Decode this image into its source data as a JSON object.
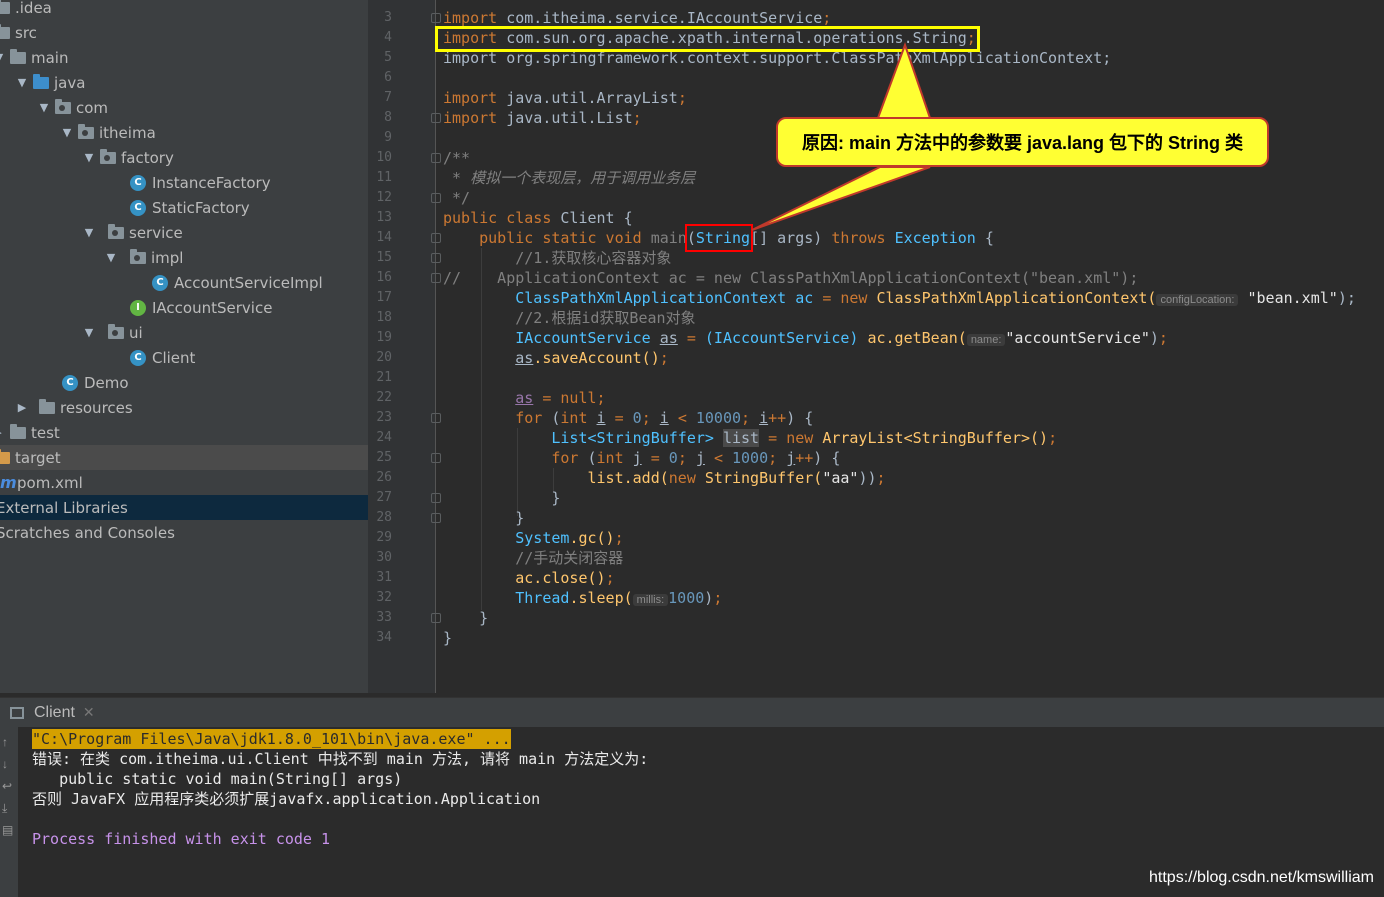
{
  "project_tree": {
    "items": [
      {
        "label": ".idea"
      },
      {
        "label": "src"
      },
      {
        "label": "main"
      },
      {
        "label": "java"
      },
      {
        "label": "com"
      },
      {
        "label": "itheima"
      },
      {
        "label": "factory"
      },
      {
        "label": "InstanceFactory"
      },
      {
        "label": "StaticFactory"
      },
      {
        "label": "service"
      },
      {
        "label": "impl"
      },
      {
        "label": "AccountServiceImpl"
      },
      {
        "label": "IAccountService"
      },
      {
        "label": "ui"
      },
      {
        "label": "Client"
      },
      {
        "label": "Demo"
      },
      {
        "label": "resources"
      },
      {
        "label": "test"
      },
      {
        "label": "target"
      },
      {
        "label": "pom.xml"
      },
      {
        "label": "External Libraries"
      },
      {
        "label": "Scratches and Consoles"
      }
    ]
  },
  "editor": {
    "line_numbers": [
      "3",
      "4",
      "5",
      "6",
      "7",
      "8",
      "9",
      "10",
      "11",
      "12",
      "13",
      "14",
      "15",
      "16",
      "17",
      "18",
      "19",
      "20",
      "21",
      "22",
      "23",
      "24",
      "25",
      "26",
      "27",
      "28",
      "29",
      "30",
      "31",
      "32",
      "33",
      "34"
    ]
  },
  "code": {
    "l3": "import com.itheima.service.IAccountService;",
    "l4_kw": "import",
    "l4_rest": " com.sun.org.apache.xpath.internal.operations.String",
    "l4_semi": ";",
    "l5": "import org.springframework.context.support.ClassPathXmlApplicationContext;",
    "l7_kw": "import",
    "l7_rest": " java.util.ArrayList",
    "l8_kw": "import",
    "l8_rest": " java.util.List",
    "l10": "/**",
    "l11": " * 模拟一个表现层，用于调用业务层",
    "l12": " */",
    "l13_kw": "public class",
    "l13_rest": " Client {",
    "l14_kw": "public static void",
    "l14_main": " main",
    "l14_string": "String",
    "l14_args": "[] args)",
    "l14_throws": "throws",
    "l14_exc": "Exception",
    "l15": "//1.获取核心容器对象",
    "l16": "//    ApplicationContext ac = new ClassPathXmlApplicationContext(\"bean.xml\");",
    "l17_type": "ClassPathXmlApplicationContext",
    "l17_var": " ac",
    "l17_new": "new",
    "l17_ctor": "ClassPathXmlApplicationContext(",
    "l17_hint": "configLocation:",
    "l17_str": "\"bean.xml\"",
    "l18": "//2.根据id获取Bean对象",
    "l19_type": "IAccountService",
    "l19_var": "as",
    "l19_cast": "(IAccountService)",
    "l19_call": "ac.getBean(",
    "l19_hint": "name:",
    "l19_str": "\"accountService\"",
    "l20_var": "as",
    "l20_call": ".saveAccount()",
    "l22_var": "as",
    "l22_rest": " = null;",
    "l23_for": "for",
    "l23_int": "int",
    "l23_i": "i",
    "l23_num": "10000",
    "l24_list": "List<StringBuffer>",
    "l24_var": "list",
    "l24_new": "new",
    "l24_ctor": "ArrayList<StringBuffer>()",
    "l25_for": "for",
    "l25_int": "int",
    "l25_j": "j",
    "l25_num": "1000",
    "l26_call": "list.add(",
    "l26_new": "new",
    "l26_ctor": "StringBuffer(",
    "l26_str": "\"aa\"",
    "l27": "}",
    "l28": "}",
    "l29_type": "System",
    "l29_call": ".gc()",
    "l30": "//手动关闭容器",
    "l31_call": "ac.close()",
    "l32_type": "Thread",
    "l32_call": ".sleep(",
    "l32_hint": "millis:",
    "l32_num": "1000",
    "l33": "}",
    "l34": "}"
  },
  "annotation": {
    "callout_text": "原因: main 方法中的参数要 java.lang 包下的 String 类"
  },
  "run_panel": {
    "tab_label": "Client",
    "lines": [
      "\"C:\\Program Files\\Java\\jdk1.8.0_101\\bin\\java.exe\" ...",
      "错误: 在类 com.itheima.ui.Client 中找不到 main 方法, 请将 main 方法定义为:",
      "   public static void main(String[] args)",
      "否则 JavaFX 应用程序类必须扩展javafx.application.Application",
      "",
      "Process finished with exit code 1"
    ]
  },
  "watermark": "https://blog.csdn.net/kmswilliam",
  "colors": {
    "highlight_box": "#ffff00",
    "error_box": "#ff0000",
    "callout_bg": "#ffff33"
  }
}
